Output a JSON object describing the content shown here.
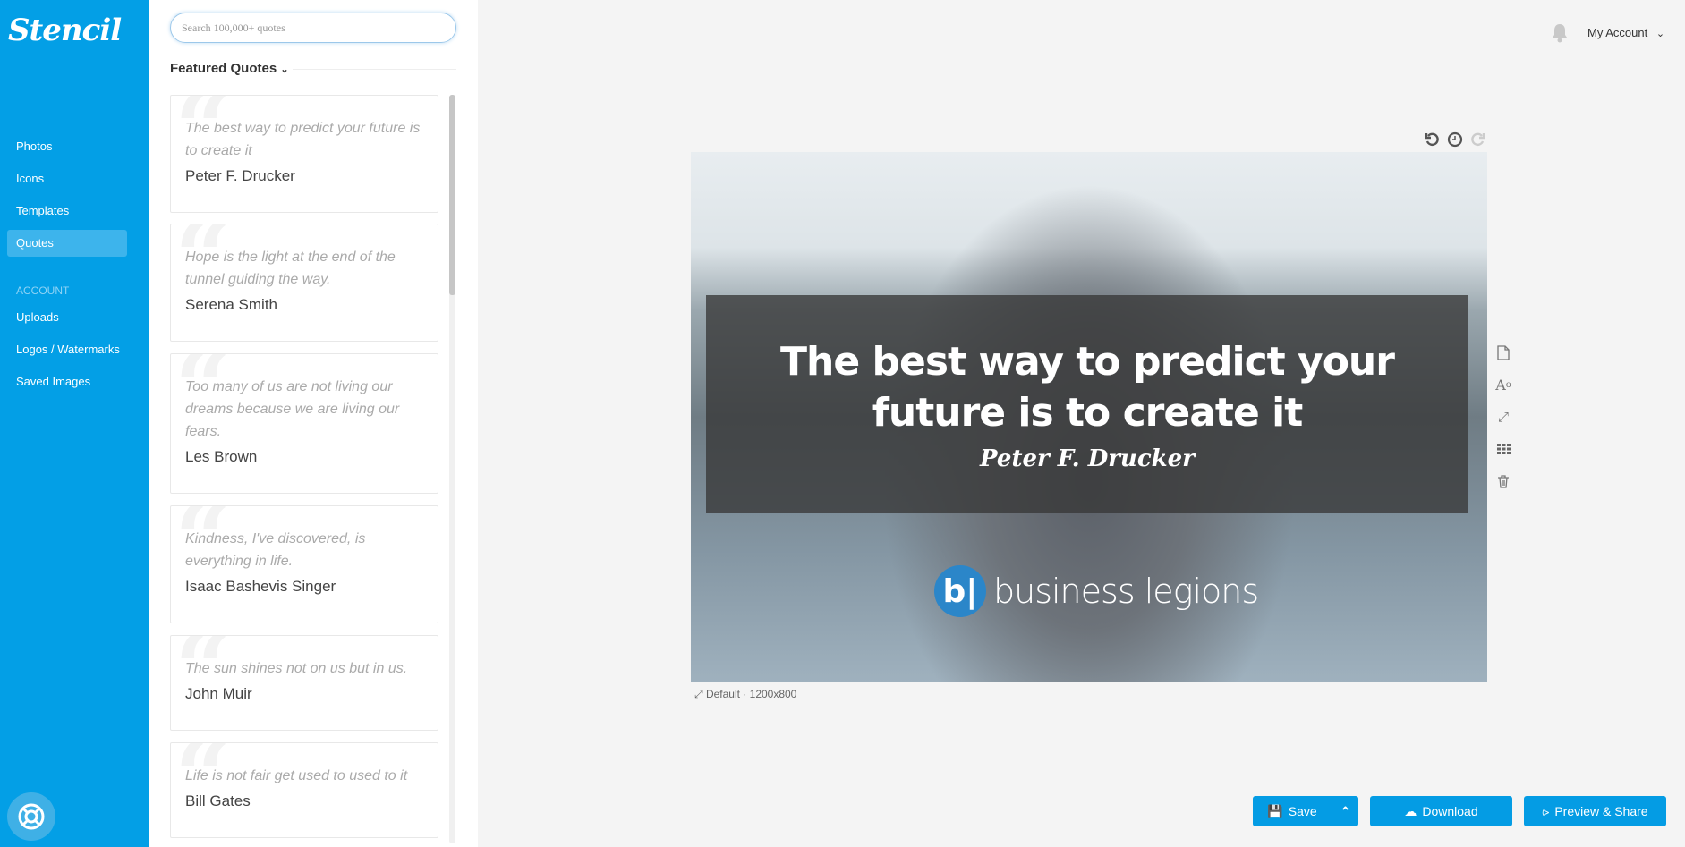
{
  "app": {
    "logo": "Stencil"
  },
  "sidebar": {
    "items": [
      {
        "label": "Photos"
      },
      {
        "label": "Icons"
      },
      {
        "label": "Templates"
      },
      {
        "label": "Quotes",
        "active": true
      }
    ],
    "account_heading": "ACCOUNT",
    "account_items": [
      {
        "label": "Uploads"
      },
      {
        "label": "Logos / Watermarks"
      },
      {
        "label": "Saved Images"
      }
    ],
    "help_icon": "lifebuoy-icon"
  },
  "quotes_panel": {
    "search_placeholder": "Search 100,000+ quotes",
    "section_title": "Featured Quotes",
    "quotes": [
      {
        "text": "The best way to predict your future is to create it",
        "author": "Peter F. Drucker"
      },
      {
        "text": "Hope is the light at the end of the tunnel guiding the way.",
        "author": "Serena Smith"
      },
      {
        "text": "Too many of us are not living our dreams because we are living our fears.",
        "author": "Les Brown"
      },
      {
        "text": "Kindness, I've discovered, is everything in life.",
        "author": "Isaac Bashevis Singer"
      },
      {
        "text": "The sun shines not on us but in us.",
        "author": "John Muir"
      },
      {
        "text": "Life is not fair get used to used to it",
        "author": "Bill Gates"
      }
    ]
  },
  "header": {
    "account_label": "My Account"
  },
  "canvas": {
    "quote": "The best way to predict your future is to create it",
    "author": "Peter F. Drucker",
    "watermark": "business legions",
    "size_label": "Default · 1200x800"
  },
  "actions": {
    "save": "Save",
    "download": "Download",
    "preview_share": "Preview & Share"
  },
  "colors": {
    "brand": "#039fe6",
    "button": "#049ce4"
  }
}
